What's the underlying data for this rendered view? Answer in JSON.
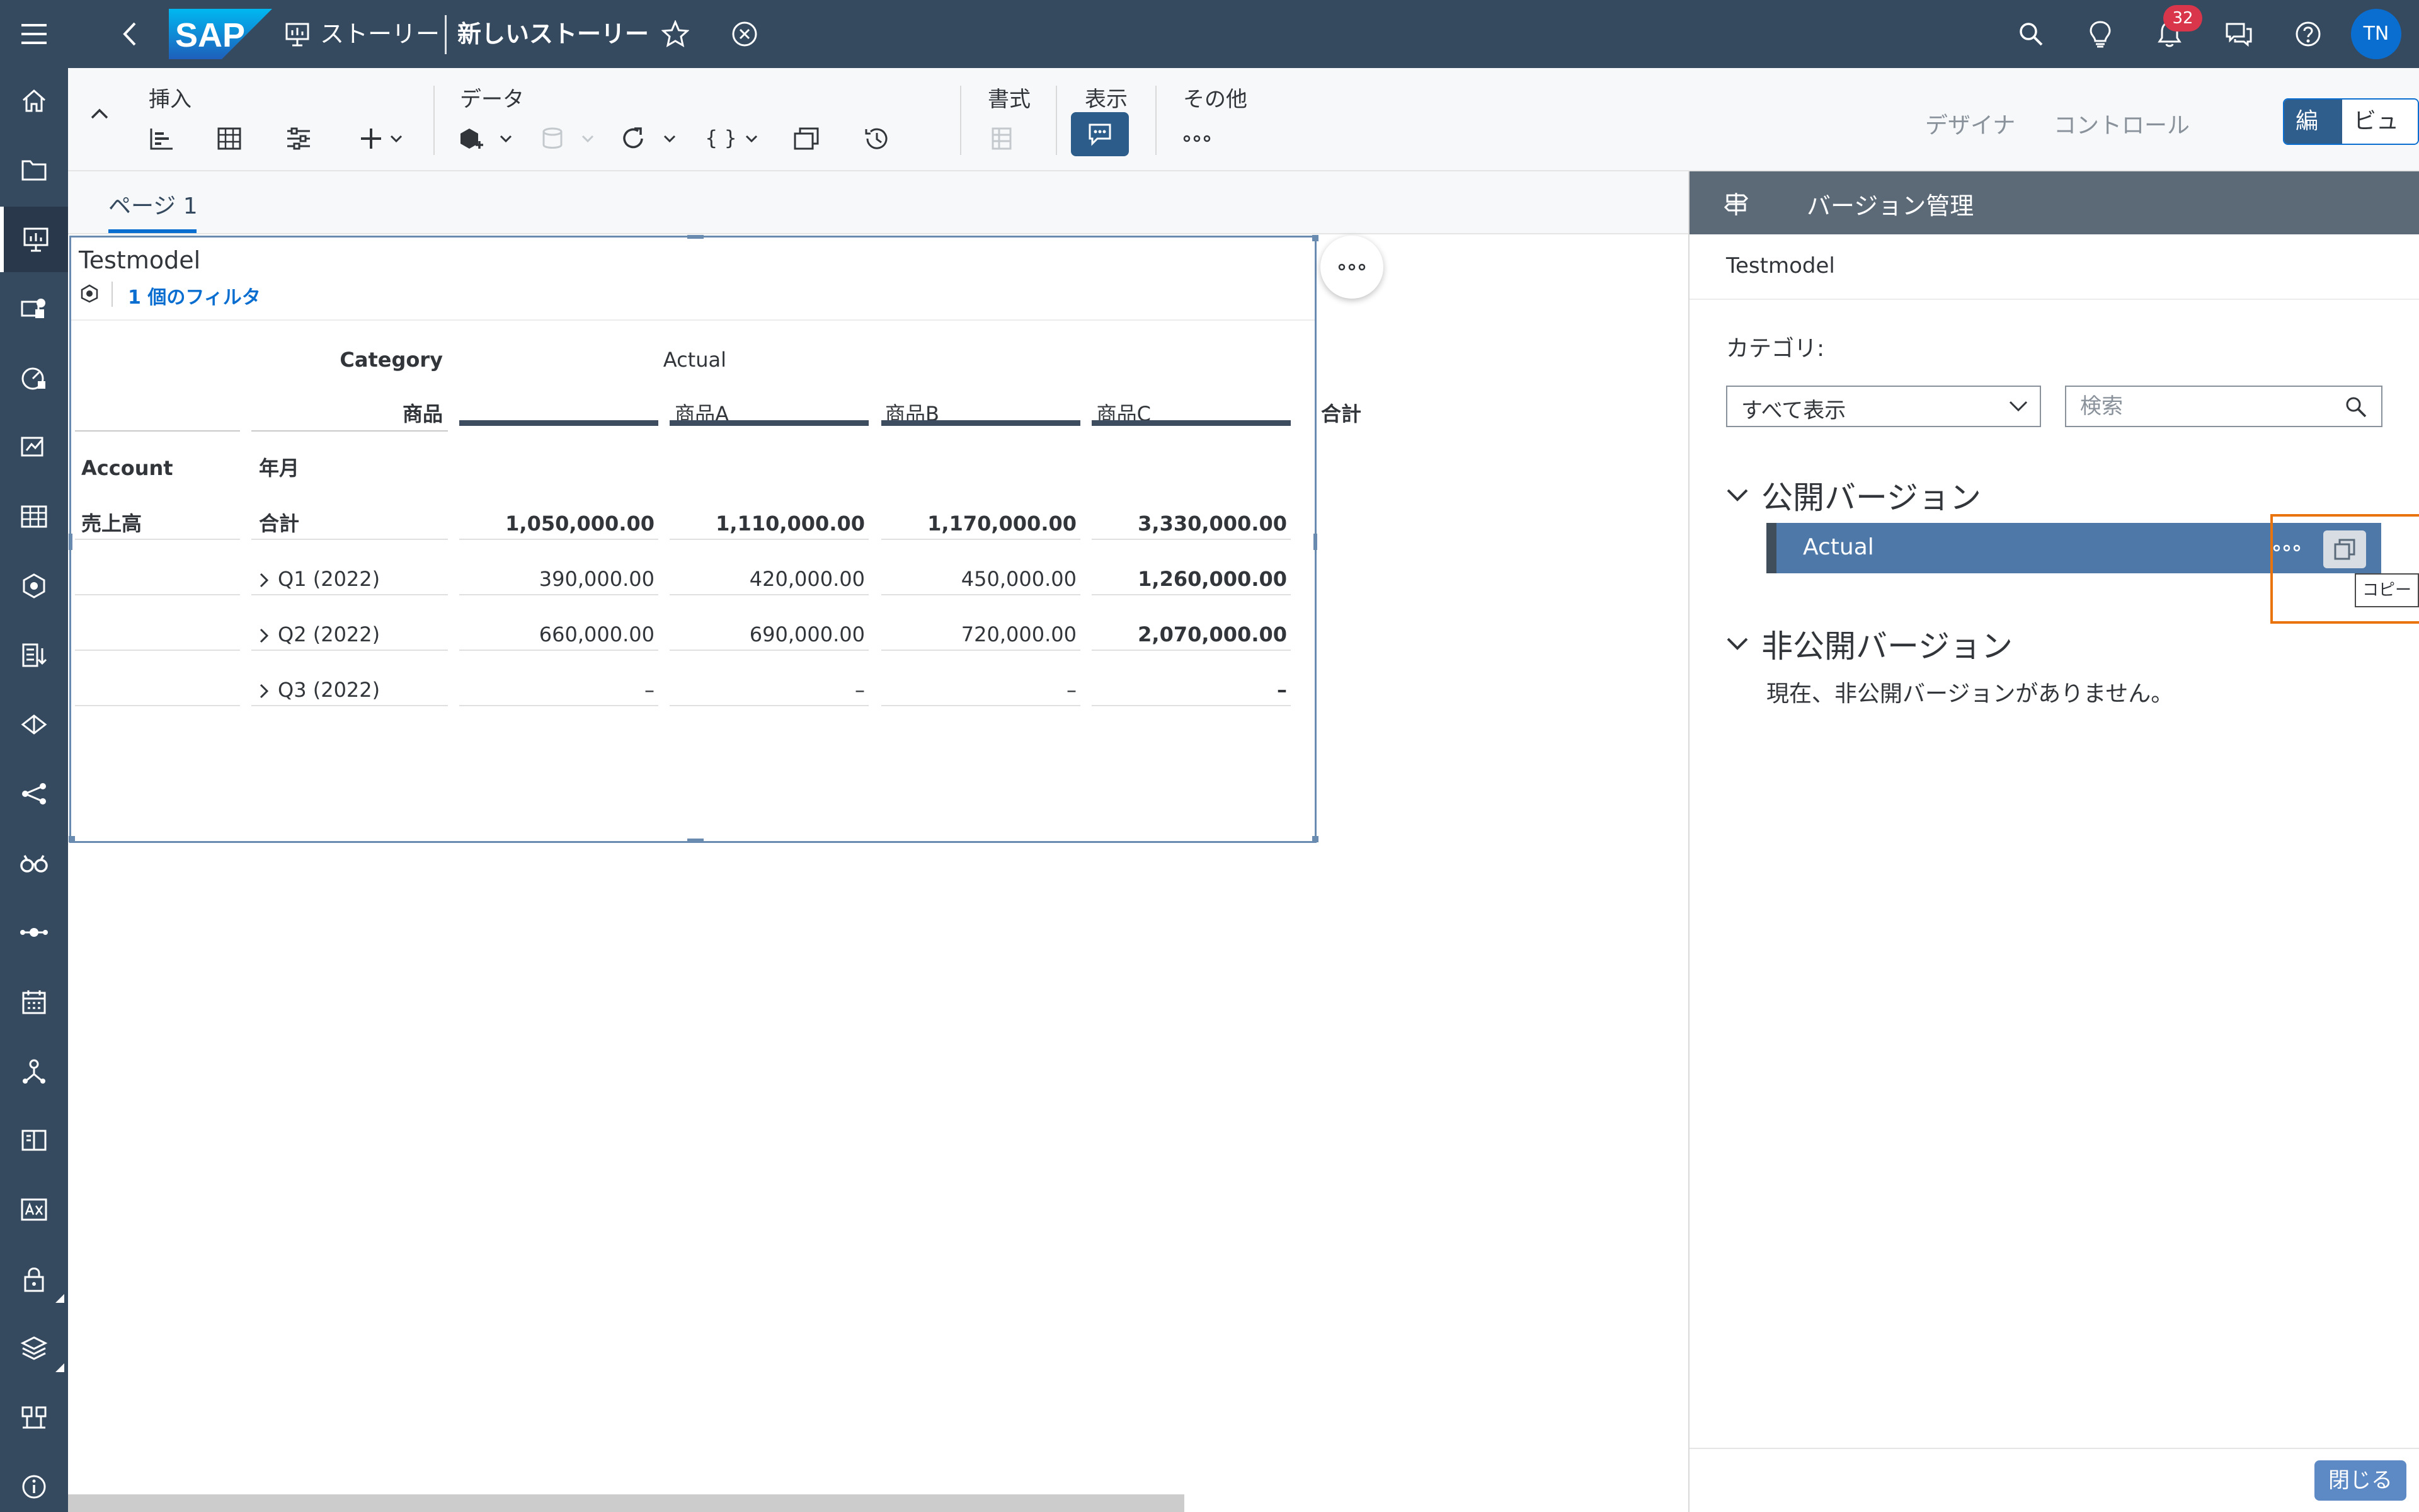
{
  "shell": {
    "breadcrumb": "ストーリー",
    "story_title": "新しいストーリー",
    "notification_count": "32",
    "user_initials": "TN"
  },
  "toolbar": {
    "groups": {
      "insert": "挿入",
      "data": "データ",
      "format": "書式",
      "view": "表示",
      "more": "その他"
    },
    "modes": {
      "designer": "デザイナ",
      "control": "コントロール"
    },
    "toggle": {
      "edit": "編集",
      "view": "ビュー"
    }
  },
  "page": {
    "tab_label": "ページ 1"
  },
  "widget": {
    "title": "Testmodel",
    "filter_text": "1 個のフィルタ",
    "header": {
      "category_label": "Category",
      "category_value": "Actual",
      "product_label": "商品",
      "columns": [
        "商品A",
        "商品B",
        "商品C",
        "合計"
      ],
      "account_label": "Account",
      "date_label": "年月"
    },
    "rows": [
      {
        "account": "売上高",
        "period": "合計",
        "values": [
          "1,050,000.00",
          "1,110,000.00",
          "1,170,000.00",
          "3,330,000.00"
        ]
      },
      {
        "account": "",
        "period": "Q1 (2022)",
        "values": [
          "390,000.00",
          "420,000.00",
          "450,000.00",
          "1,260,000.00"
        ]
      },
      {
        "account": "",
        "period": "Q2 (2022)",
        "values": [
          "660,000.00",
          "690,000.00",
          "720,000.00",
          "2,070,000.00"
        ]
      },
      {
        "account": "",
        "period": "Q3 (2022)",
        "values": [
          "–",
          "–",
          "–",
          "–"
        ]
      }
    ]
  },
  "panel": {
    "title": "バージョン管理",
    "model": "Testmodel",
    "category_label": "カテゴリ:",
    "category_selected": "すべて表示",
    "search_placeholder": "検索",
    "public_group": "公開バージョン",
    "public_versions": [
      "Actual"
    ],
    "private_group": "非公開バージョン",
    "private_empty": "現在、非公開バージョンがありません。",
    "copy_tooltip": "コピー",
    "close_label": "閉じる"
  },
  "colors": {
    "shell": "#354a5f",
    "accent": "#0a6ed1",
    "selected_version": "#4e78a8",
    "highlight": "#e9730c",
    "badge": "#d9364c"
  }
}
